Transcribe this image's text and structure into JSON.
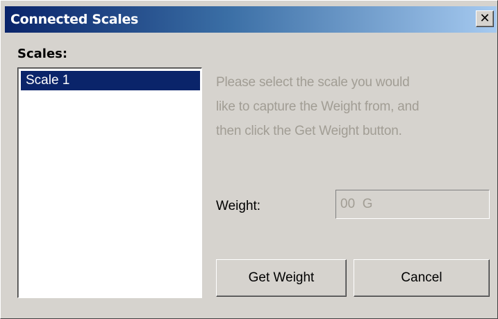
{
  "window": {
    "title": "Connected Scales",
    "close_glyph": "✕"
  },
  "scales": {
    "label": "Scales:",
    "items": [
      {
        "label": "Scale 1",
        "selected": true
      }
    ]
  },
  "instructions": {
    "line1": "Please select the scale you would",
    "line2": "like to capture the Weight from, and",
    "line3": "then click the Get Weight button."
  },
  "weight": {
    "label": "Weight:",
    "value": "00  G"
  },
  "buttons": {
    "get_weight": "Get Weight",
    "cancel": "Cancel"
  },
  "colors": {
    "titlebar_start": "#0a246a",
    "titlebar_end": "#a6caf0",
    "face": "#d6d3ce",
    "selection": "#0a246a",
    "disabled_text": "#a19d94"
  },
  "icons": {
    "close": "close-icon"
  }
}
